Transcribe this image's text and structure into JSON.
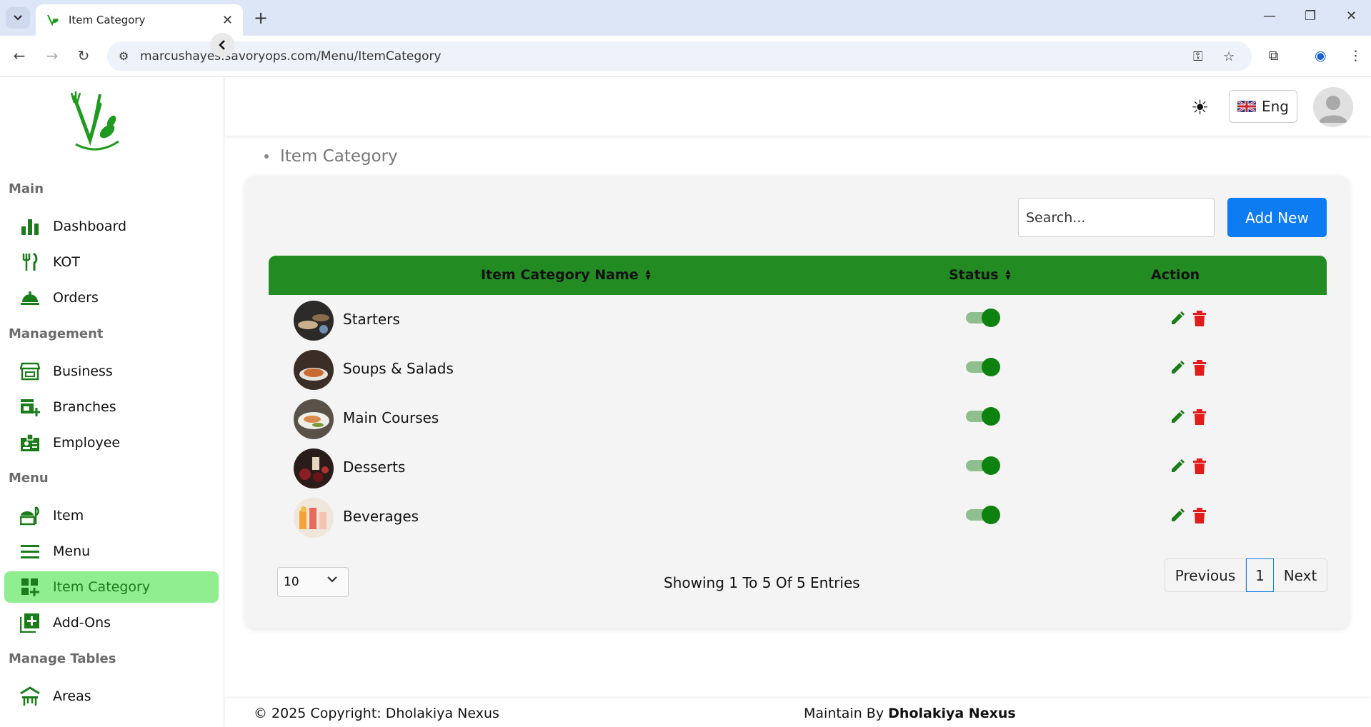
{
  "browser": {
    "tab_title": "Item Category",
    "url": "marcushayes.savoryops.com/Menu/ItemCategory",
    "new_tab": "+",
    "tab_close": "✕"
  },
  "sidebar": {
    "sections": [
      {
        "label": "Main",
        "items": [
          {
            "label": "Dashboard",
            "icon": "bar-chart-icon"
          },
          {
            "label": "KOT",
            "icon": "fork-knife-icon"
          },
          {
            "label": "Orders",
            "icon": "cloche-icon"
          }
        ]
      },
      {
        "label": "Management",
        "items": [
          {
            "label": "Business",
            "icon": "storefront-icon"
          },
          {
            "label": "Branches",
            "icon": "add-business-icon"
          },
          {
            "label": "Employee",
            "icon": "badge-icon"
          }
        ]
      },
      {
        "label": "Menu",
        "items": [
          {
            "label": "Item",
            "icon": "food-item-icon"
          },
          {
            "label": "Menu",
            "icon": "menu-lines-icon"
          },
          {
            "label": "Item Category",
            "icon": "dashboard-add-icon",
            "active": true
          },
          {
            "label": "Add-Ons",
            "icon": "library-add-icon"
          }
        ]
      },
      {
        "label": "Manage Tables",
        "items": [
          {
            "label": "Areas",
            "icon": "table-area-icon"
          }
        ]
      }
    ]
  },
  "header": {
    "language": "Eng"
  },
  "breadcrumb": "Item Category",
  "toolbar": {
    "search_placeholder": "Search...",
    "add_new": "Add New"
  },
  "table": {
    "columns": [
      "Item Category Name",
      "Status",
      "Action"
    ],
    "rows": [
      {
        "name": "Starters",
        "status": true
      },
      {
        "name": "Soups & Salads",
        "status": true
      },
      {
        "name": "Main Courses",
        "status": true
      },
      {
        "name": "Desserts",
        "status": true
      },
      {
        "name": "Beverages",
        "status": true
      }
    ]
  },
  "pagination": {
    "page_size": "10",
    "info": "Showing 1 To 5 Of 5 Entries",
    "previous": "Previous",
    "current": "1",
    "next": "Next"
  },
  "footer": {
    "copyright": "© 2025 Copyright: Dholakiya Nexus",
    "maintain_prefix": "Maintain By ",
    "maintain_by": "Dholakiya Nexus"
  },
  "colors": {
    "brand_green": "#228b22",
    "active_nav_bg": "#90ee90",
    "primary_button": "#0d7bf2",
    "delete_red": "#e21b1b"
  }
}
